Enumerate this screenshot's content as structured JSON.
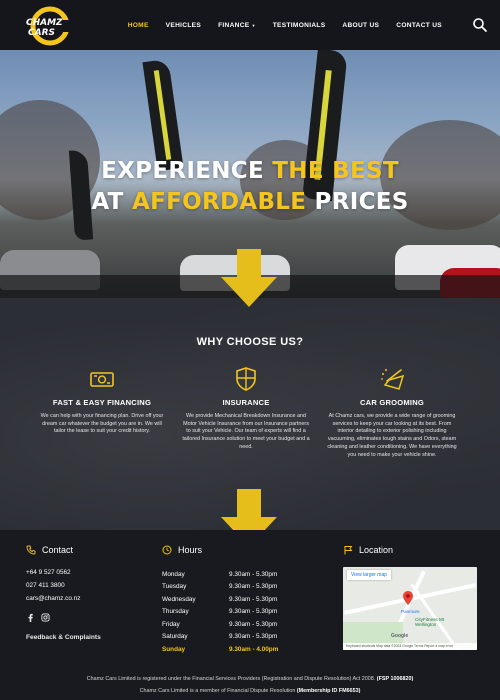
{
  "brand": {
    "logo_line1": "CHAMZ",
    "logo_line2": "CARS",
    "accent": "#f4c51d"
  },
  "nav": {
    "items": [
      {
        "label": "HOME",
        "active": true
      },
      {
        "label": "VEHICLES"
      },
      {
        "label": "FINANCE",
        "has_dropdown": true
      },
      {
        "label": "TESTIMONIALS"
      },
      {
        "label": "ABOUT US"
      },
      {
        "label": "CONTACT US"
      }
    ],
    "caret": "▼",
    "search_icon": "search-icon"
  },
  "hero": {
    "line1_white": "EXPERIENCE ",
    "line1_yellow": "THE BEST",
    "line2_white_a": "AT ",
    "line2_yellow": "AFFORDABLE",
    "line2_white_b": " PRICES"
  },
  "why": {
    "title": "WHY CHOOSE US?",
    "features": [
      {
        "icon": "cash-icon",
        "title": "FAST & EASY FINANCING",
        "text": "We can help with your financing plan. Drive off your dream car whatever the budget you are in. We will tailor the lease to suit your credit history."
      },
      {
        "icon": "shield-icon",
        "title": "INSURANCE",
        "text": "We provide Mechanical Breakdown Insurance and Motor Vehicle Insurance from our Insurance partners to suit your Vehicle. Our team of experts will find a tailored Insurance solution to meet your budget and a need."
      },
      {
        "icon": "vacuum-icon",
        "title": "CAR GROOMING",
        "text": "At Chamz cars, we provide a wide range of grooming services to keep your car looking at its best. From interior detailing to exterior polishing including vacuuming, eliminates tough stains and Odors, steam cleaning and leather conditioning. We have everything you need to make your vehicle shine."
      }
    ]
  },
  "contact": {
    "heading": "Contact",
    "phone1": "+64 9 527 0562",
    "phone2": "027 411 3800",
    "email": "cars@chamz.co.nz",
    "feedback": "Feedback & Complaints"
  },
  "hours": {
    "heading": "Hours",
    "rows": [
      {
        "day": "Monday",
        "time": "9.30am - 5.30pm"
      },
      {
        "day": "Tuesday",
        "time": "9.30am - 5.30pm"
      },
      {
        "day": "Wednesday",
        "time": "9.30am - 5.30pm"
      },
      {
        "day": "Thursday",
        "time": "9.30am - 5.30pm"
      },
      {
        "day": "Friday",
        "time": "9.30am - 5.30pm"
      },
      {
        "day": "Saturday",
        "time": "9.30am - 5.30pm"
      },
      {
        "day": "Sunday",
        "time": "9.30am - 4.00pm",
        "highlight": true
      }
    ]
  },
  "location": {
    "heading": "Location",
    "map_link": "View larger map",
    "map_labels": [
      "Panmure",
      "CityFitness Mt Wellington",
      "Google"
    ],
    "map_footer": "Keyboard shortcuts  Map data ©2024 Google  Terms  Report a map error"
  },
  "footer": {
    "line1_a": "Chamz Cars Limited is registered under the Financial Services Providers (Registration and Dispute Resolution) Act 2008. ",
    "line1_b": "(FSP 1006820)",
    "line2_a": "Chamz Cars Limited is a member of Financial Dispute Resolution ",
    "line2_b": "(Membership ID FM6653)"
  }
}
